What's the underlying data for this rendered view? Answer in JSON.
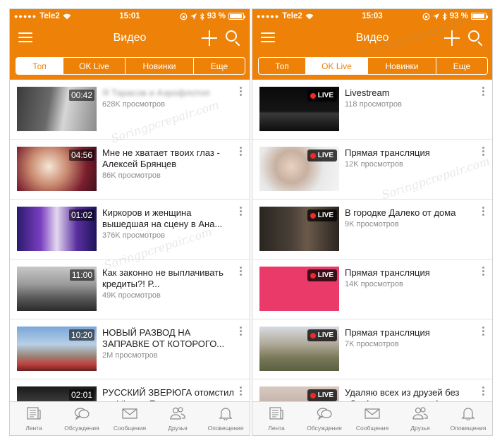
{
  "status_left": {
    "carrier": "Tele2",
    "time": "15:01",
    "battery": "93 %"
  },
  "status_right": {
    "carrier": "Tele2",
    "time": "15:03",
    "battery": "93 %"
  },
  "nav": {
    "title": "Видео"
  },
  "tabs": [
    "Топ",
    "OK Live",
    "Новинки",
    "Еще"
  ],
  "left_list": [
    {
      "time": "00:42",
      "title": "Я Тарасов и Аэрофлотоп",
      "views": "628K просмотров"
    },
    {
      "time": "04:56",
      "title": "Мне не хватает твоих глаз - Алексей Брянцев",
      "views": "86K просмотров"
    },
    {
      "time": "01:02",
      "title": "Киркоров и женщина вышедшая на сцену в Ана...",
      "views": "376K просмотров"
    },
    {
      "time": "11:00",
      "title": "Как законно не выплачивать кредиты?! Р...",
      "views": "49K просмотров"
    },
    {
      "time": "10:20",
      "title": "НОВЫЙ РАЗВОД НА ЗАПРАВКЕ ОТ КОТОРОГО...",
      "views": "2M просмотров"
    },
    {
      "time": "02:01",
      "title": "РУССКИЙ ЗВЕРЮГА отомстил за Фёдора Емел...",
      "views": ""
    }
  ],
  "right_list": [
    {
      "title": "Livestream",
      "views": "118 просмотров"
    },
    {
      "title": "Прямая трансляция",
      "views": "12K просмотров"
    },
    {
      "title": "В городке Далеко от дома",
      "views": "9K просмотров"
    },
    {
      "title": "Прямая трансляция",
      "views": "14K просмотров"
    },
    {
      "title": "Прямая трансляция",
      "views": "7K просмотров"
    },
    {
      "title": "Удаляю всех из друзей без обид(кроме жен роло)",
      "views": ""
    }
  ],
  "live_label": "LIVE",
  "bottom_nav": [
    "Лента",
    "Обсуждения",
    "Сообщения",
    "Друзья",
    "Оповещения"
  ],
  "watermark": "Soringpcrepair.com",
  "colors": {
    "accent": "#ee8208",
    "live_dot": "#ee2a2a"
  }
}
